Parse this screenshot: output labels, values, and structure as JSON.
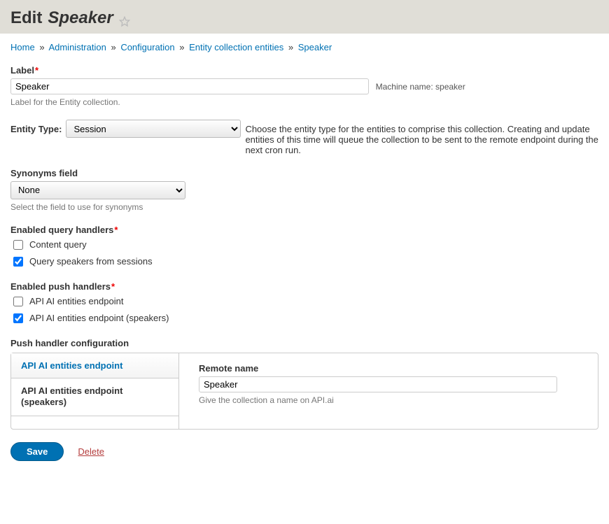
{
  "header": {
    "title_prefix": "Edit",
    "title_entity": "Speaker"
  },
  "breadcrumb": [
    {
      "label": "Home"
    },
    {
      "label": "Administration"
    },
    {
      "label": "Configuration"
    },
    {
      "label": "Entity collection entities"
    },
    {
      "label": "Speaker"
    }
  ],
  "label_field": {
    "title": "Label",
    "value": "Speaker",
    "machine_name_prefix": "Machine name:",
    "machine_name_value": "speaker",
    "help": "Label for the Entity collection."
  },
  "entity_type": {
    "title": "Entity Type:",
    "value": "Session",
    "help": "Choose the entity type for the entities to comprise this collection. Creating and update entities of this time will queue the collection to be sent to the remote endpoint during the next cron run."
  },
  "synonyms": {
    "title": "Synonyms field",
    "value": "None",
    "help": "Select the field to use for synonyms"
  },
  "query_handlers": {
    "title": "Enabled query handlers",
    "options": [
      {
        "label": "Content query",
        "checked": false
      },
      {
        "label": "Query speakers from sessions",
        "checked": true
      }
    ]
  },
  "push_handlers": {
    "title": "Enabled push handlers",
    "options": [
      {
        "label": "API AI entities endpoint",
        "checked": false
      },
      {
        "label": "API AI entities endpoint (speakers)",
        "checked": true
      }
    ]
  },
  "push_config": {
    "title": "Push handler configuration",
    "tabs": [
      {
        "label": "API AI entities endpoint",
        "active": true
      },
      {
        "label": "API AI entities endpoint (speakers)",
        "active": false
      }
    ],
    "remote_name_title": "Remote name",
    "remote_name_value": "Speaker",
    "remote_name_help": "Give the collection a name on API.ai"
  },
  "actions": {
    "save": "Save",
    "delete": "Delete"
  }
}
